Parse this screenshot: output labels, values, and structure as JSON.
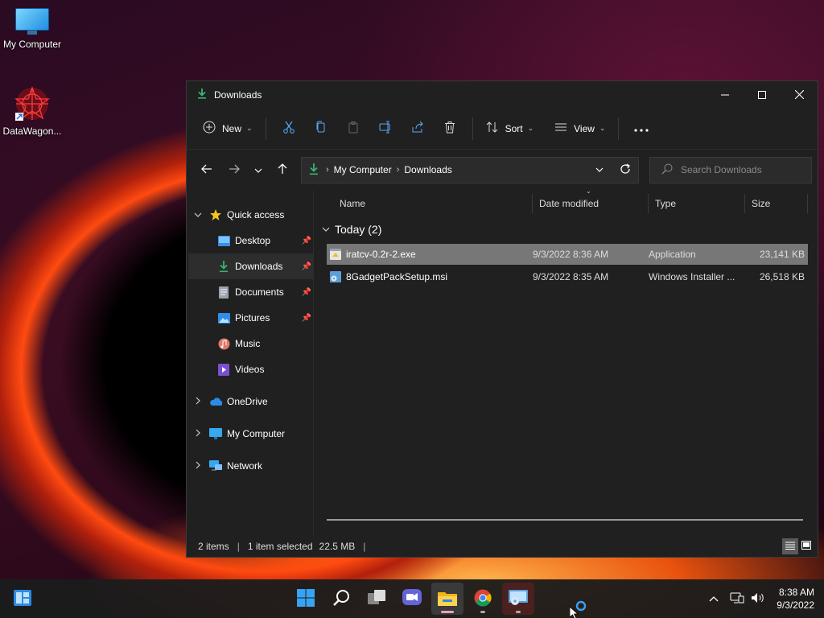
{
  "desktop": {
    "icons": [
      {
        "label": "My Computer"
      },
      {
        "label": "DataWagon..."
      }
    ]
  },
  "window": {
    "title": "Downloads",
    "toolbar": {
      "new_label": "New",
      "sort_label": "Sort",
      "view_label": "View"
    },
    "address": {
      "crumbs": [
        "My Computer",
        "Downloads"
      ]
    },
    "search": {
      "placeholder": "Search Downloads"
    },
    "sidebar": {
      "quick_access": "Quick access",
      "items": [
        {
          "label": "Desktop"
        },
        {
          "label": "Downloads"
        },
        {
          "label": "Documents"
        },
        {
          "label": "Pictures"
        },
        {
          "label": "Music"
        },
        {
          "label": "Videos"
        }
      ],
      "roots": [
        {
          "label": "OneDrive"
        },
        {
          "label": "My Computer"
        },
        {
          "label": "Network"
        }
      ]
    },
    "columns": [
      "Name",
      "Date modified",
      "Type",
      "Size"
    ],
    "group": "Today (2)",
    "files": [
      {
        "name": "iratcv-0.2r-2.exe",
        "date": "9/3/2022 8:36 AM",
        "type": "Application",
        "size": "23,141 KB"
      },
      {
        "name": "8GadgetPackSetup.msi",
        "date": "9/3/2022 8:35 AM",
        "type": "Windows Installer ...",
        "size": "26,518 KB"
      }
    ],
    "status": {
      "items": "2 items",
      "selected": "1 item selected",
      "selected_size": "22.5 MB"
    }
  },
  "taskbar": {
    "time": "8:38 AM",
    "date": "9/3/2022"
  },
  "colors": {
    "accent": "#0078d4",
    "window_bg": "#202020",
    "selection": "#777777",
    "download_green": "#3bb273"
  }
}
